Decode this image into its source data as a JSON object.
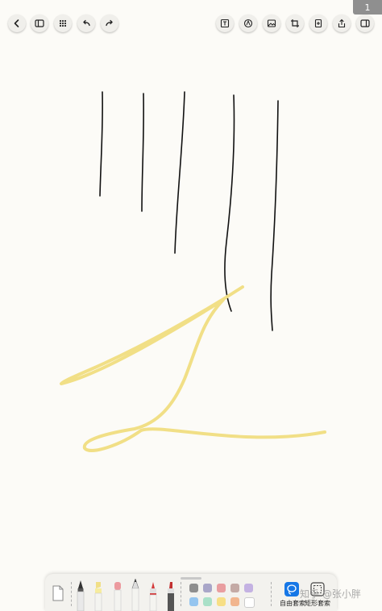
{
  "page_indicator": "1",
  "watermark": "知乎 @张小胖",
  "toolbar_left": {
    "back_icon": "chevron-left-icon",
    "sidebar_icon": "sidebar-icon",
    "grid_icon": "grid-icon",
    "undo_icon": "undo-icon",
    "redo_icon": "redo-icon"
  },
  "toolbar_right": {
    "text_icon": "text-box-icon",
    "shape_icon": "shape-icon",
    "image_icon": "image-icon",
    "crop_icon": "crop-icon",
    "add_page_icon": "add-page-icon",
    "share_icon": "share-icon",
    "panel_icon": "split-panel-icon"
  },
  "ink": {
    "black_stroke_color": "#111111",
    "highlighter_color": "#f1df86"
  },
  "palette": {
    "row1": [
      "#8e8e8e",
      "#a9a6c8",
      "#e99ea0",
      "#c4aaa5",
      "#c4b2e2"
    ],
    "row2": [
      "#95c5ef",
      "#a9e0c8",
      "#f7df86",
      "#f1b58e",
      "#ffffff"
    ]
  },
  "tools": {
    "eraser": "eraser-tool",
    "fountain_pen": "fountain-pen-tool",
    "highlighter": "highlighter-tool",
    "pink_eraser": "pink-eraser-tool",
    "pencil": "pencil-tool",
    "red_pen": "red-pen-tool",
    "marker": "marker-tool"
  },
  "lasso": {
    "free_label": "自由套索",
    "rect_label": "矩形套索"
  }
}
